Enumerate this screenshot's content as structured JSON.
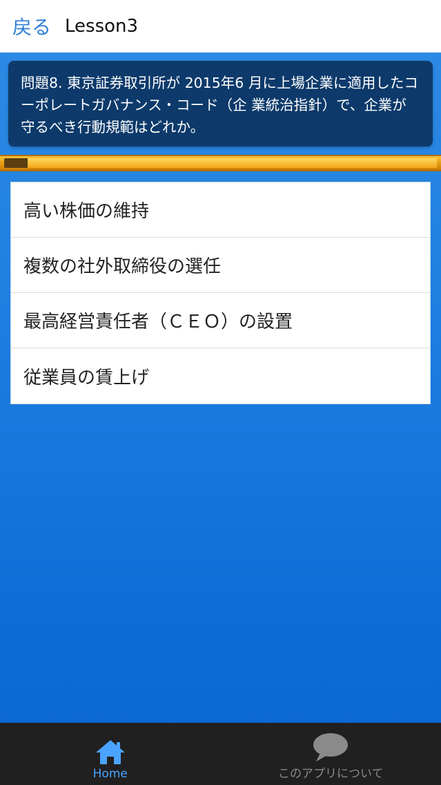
{
  "header": {
    "back_label": "戻る",
    "title": "Lesson3"
  },
  "question": {
    "text": "問題8. 東京証券取引所が 2015年6 月に上場企業に適用したコーポレートガバナンス・コード（企 業統治指針）で、企業が守るべき行動規範はどれか。"
  },
  "progress": {
    "fraction": 0.055,
    "fill_color": "#5a3e12",
    "track_color": "#f5a61a"
  },
  "answers": [
    {
      "label": "高い株価の維持"
    },
    {
      "label": "複数の社外取締役の選任"
    },
    {
      "label": "最高経営責任者（ＣＥＯ）の設置"
    },
    {
      "label": "従業員の賃上げ"
    }
  ],
  "tabs": {
    "home": {
      "label": "Home",
      "icon": "home-icon",
      "color": "#4aa3ff"
    },
    "about": {
      "label": "このアプリについて",
      "icon": "chat-bubble-icon",
      "color": "#8a8a8a"
    }
  }
}
